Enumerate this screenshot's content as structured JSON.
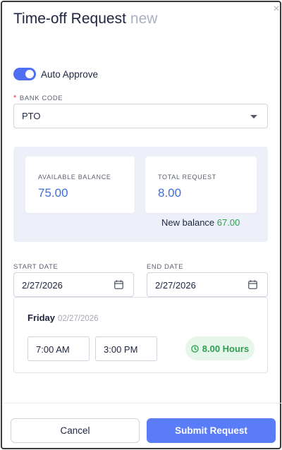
{
  "dialog": {
    "title": "Time-off Request",
    "title_suffix": "new",
    "close_glyph": "×"
  },
  "auto_approve": {
    "label": "Auto Approve",
    "enabled": true
  },
  "bank_code": {
    "label": "BANK CODE",
    "required_marker": "*",
    "value": "PTO"
  },
  "balance": {
    "available_label": "AVAILABLE BALANCE",
    "available_value": "75.00",
    "total_label": "TOTAL REQUEST",
    "total_value": "8.00",
    "new_balance_label": "New balance",
    "new_balance_value": "67.00"
  },
  "dates": {
    "start_label": "START DATE",
    "start_value": "2/27/2026",
    "end_label": "END DATE",
    "end_value": "2/27/2026"
  },
  "day": {
    "name": "Friday",
    "date": "02/27/2026",
    "start_time": "7:00 AM",
    "end_time": "3:00 PM",
    "hours": "8.00 Hours"
  },
  "footer": {
    "cancel_label": "Cancel",
    "submit_label": "Submit Request"
  },
  "colors": {
    "accent": "#4f6ef2",
    "submit": "#5b7cf7",
    "balance_value": "#3d6fe0",
    "positive": "#2e9e4f",
    "panel_bg": "#eef0f9"
  }
}
